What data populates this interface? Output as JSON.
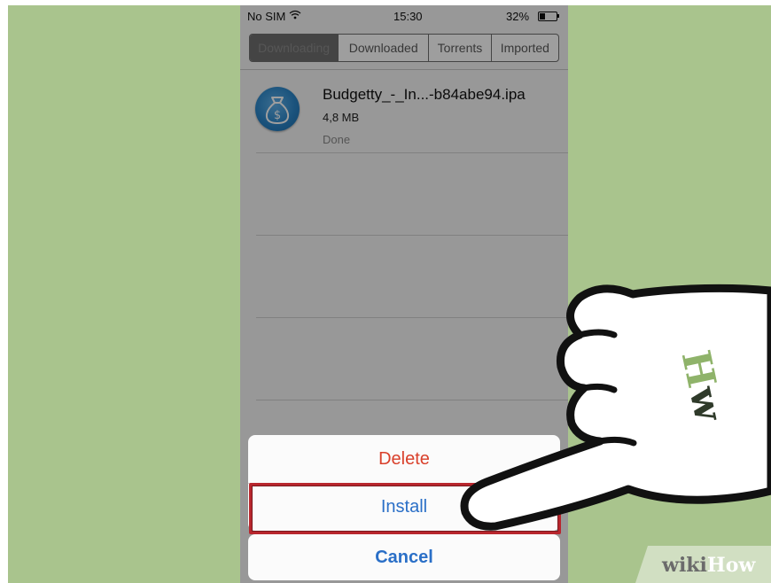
{
  "status_bar": {
    "carrier": "No SIM",
    "time": "15:30",
    "battery": "32%",
    "battery_level": 0.32
  },
  "tabs": [
    {
      "label": "Downloading",
      "active": true
    },
    {
      "label": "Downloaded",
      "active": false
    },
    {
      "label": "Torrents",
      "active": false
    },
    {
      "label": "Imported",
      "active": false
    }
  ],
  "file": {
    "name": "Budgetty_-_In...-b84abe94.ipa",
    "size": "4,8 MB",
    "status": "Done",
    "icon": "money-bag-icon"
  },
  "action_sheet": {
    "delete_label": "Delete",
    "install_label": "Install",
    "cancel_label": "Cancel"
  },
  "colors": {
    "background": "#a9c48d",
    "destructive": "#d9402b",
    "action": "#2a6fc7",
    "highlight": "#b8262d"
  },
  "watermark": {
    "wiki": "wiki",
    "how": "How"
  }
}
